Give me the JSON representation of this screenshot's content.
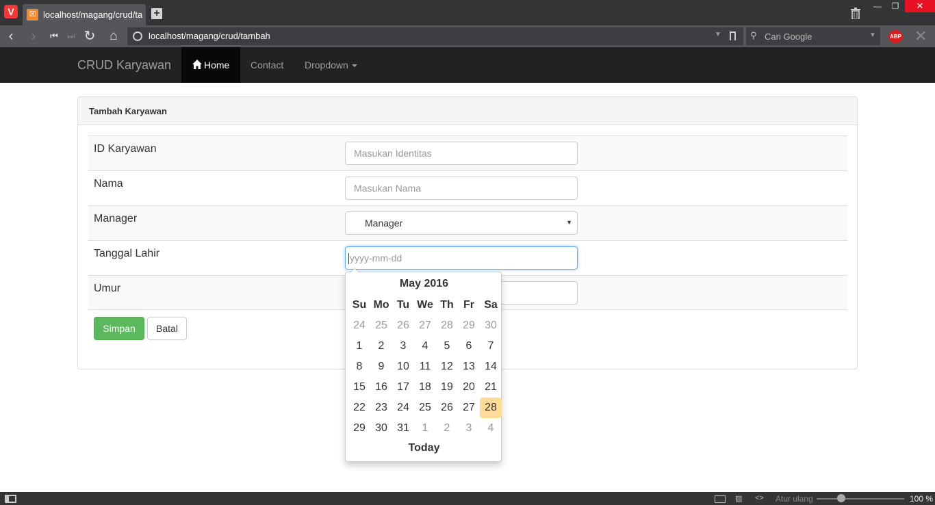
{
  "browser": {
    "tab_title": "localhost/magang/crud/tambah",
    "url": "localhost/magang/crud/tambah",
    "search_placeholder": "Cari Google",
    "abp_label": "ABP"
  },
  "navbar": {
    "brand": "CRUD Karyawan",
    "items": [
      "Home",
      "Contact",
      "Dropdown"
    ]
  },
  "form": {
    "title": "Tambah Karyawan",
    "fields": [
      {
        "label": "ID Karyawan",
        "placeholder": "Masukan Identitas"
      },
      {
        "label": "Nama",
        "placeholder": "Masukan Nama"
      },
      {
        "label": "Manager",
        "value": "Manager"
      },
      {
        "label": "Tanggal Lahir",
        "placeholder": "yyyy-mm-dd"
      },
      {
        "label": "Umur",
        "placeholder": ""
      }
    ],
    "submit_label": "Simpan",
    "cancel_label": "Batal"
  },
  "datepicker": {
    "month_label": "May 2016",
    "days_of_week": [
      "Su",
      "Mo",
      "Tu",
      "We",
      "Th",
      "Fr",
      "Sa"
    ],
    "weeks": [
      [
        "24",
        "25",
        "26",
        "27",
        "28",
        "29",
        "30"
      ],
      [
        "1",
        "2",
        "3",
        "4",
        "5",
        "6",
        "7"
      ],
      [
        "8",
        "9",
        "10",
        "11",
        "12",
        "13",
        "14"
      ],
      [
        "15",
        "16",
        "17",
        "18",
        "19",
        "20",
        "21"
      ],
      [
        "22",
        "23",
        "24",
        "25",
        "26",
        "27",
        "28"
      ],
      [
        "29",
        "30",
        "31",
        "1",
        "2",
        "3",
        "4"
      ]
    ],
    "highlighted_day": "28",
    "footer": "Today"
  },
  "statusbar": {
    "reset_label": "Atur ulang",
    "zoom": "100 %"
  }
}
